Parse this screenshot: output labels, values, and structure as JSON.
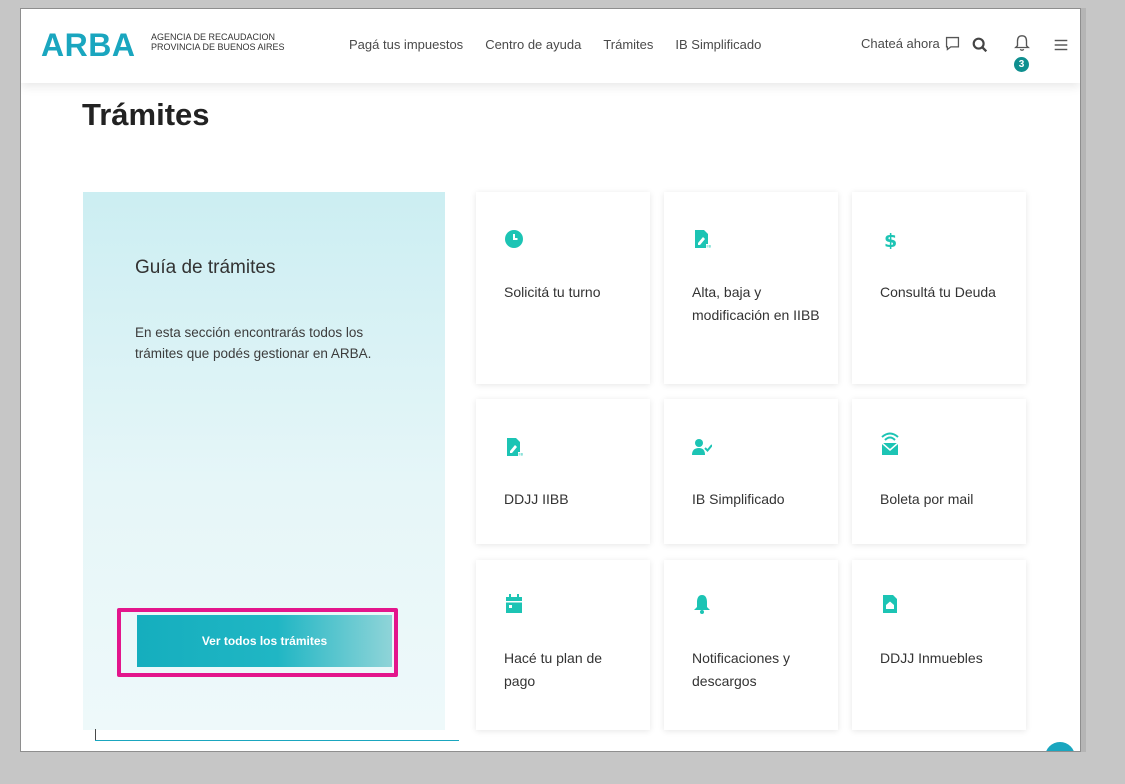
{
  "header": {
    "logo": "ARBA",
    "logo_line1": "Agencia de Recaudacion",
    "logo_line2": "Provincia de Buenos Aires",
    "nav": [
      "Pagá tus impuestos",
      "Centro de ayuda",
      "Trámites",
      "IB Simplificado"
    ],
    "chat_label": "Chateá ahora",
    "notification_count": "3"
  },
  "page": {
    "title": "Trámites"
  },
  "guide": {
    "title": "Guía de trámites",
    "text": "En esta sección encontrarás todos los trámites que podés gestionar en ARBA.",
    "button_label": "Ver todos los trámites"
  },
  "cards": [
    {
      "label": "Solicitá tu turno",
      "icon": "clock-icon"
    },
    {
      "label": "Alta, baja y modificación en IIBB",
      "icon": "document-edit-icon"
    },
    {
      "label": "Consultá tu Deuda",
      "icon": "dollar-icon"
    },
    {
      "label": "DDJJ IIBB",
      "icon": "document-edit-icon"
    },
    {
      "label": "IB Simplificado",
      "icon": "user-check-icon"
    },
    {
      "label": "Boleta por mail",
      "icon": "mail-wifi-icon"
    },
    {
      "label": "Hacé tu plan de pago",
      "icon": "calendar-icon"
    },
    {
      "label": "Notificaciones y descargos",
      "icon": "bell-icon"
    },
    {
      "label": "DDJJ Inmuebles",
      "icon": "home-document-icon"
    }
  ],
  "colors": {
    "brand": "#1aa6bf",
    "accent": "#1cc4b4",
    "highlight": "#e3168c",
    "badge": "#0f8f8f"
  }
}
